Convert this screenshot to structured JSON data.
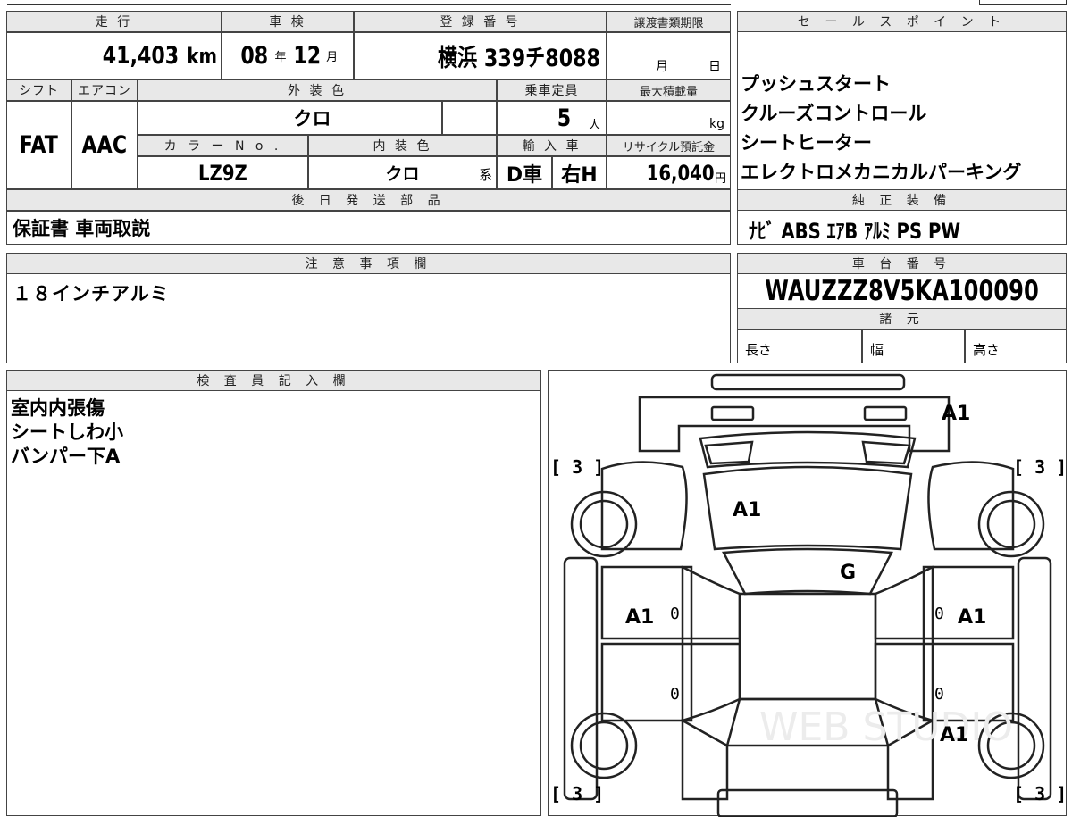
{
  "top_table": {
    "headers": {
      "mileage": "走 行",
      "inspection": "車 検",
      "registration": "登 録 番 号",
      "transfer_deadline": "譲渡書類期限",
      "shift": "シフト",
      "aircon": "エアコン",
      "exterior_color": "外 装 色",
      "capacity": "乗車定員",
      "max_load": "最大積載量",
      "color_no": "カ ラ ー N o .",
      "interior_color": "内 装 色",
      "import": "輸 入 車",
      "recycle_fee": "リサイクル預託金",
      "later_parts": "後 日 発 送 部 品"
    },
    "mileage_value": "41,403",
    "mileage_unit": "km",
    "inspection_year": "08",
    "inspection_year_unit": "年",
    "inspection_month": "12",
    "inspection_month_unit": "月",
    "registration_value": "横浜 339チ8088",
    "deadline_month": "月",
    "deadline_day": "日",
    "shift_value": "FAT",
    "aircon_value": "AAC",
    "exterior_color_value": "クロ",
    "capacity_value": "5",
    "capacity_unit": "人",
    "max_load_unit": "kg",
    "color_no_value": "LZ9Z",
    "interior_color_value": "クロ",
    "interior_color_suffix": "系",
    "import_value_1": "D車",
    "import_value_2": "右H",
    "recycle_value": "16,040",
    "recycle_unit": "円",
    "later_parts_value": "保証書 車両取説"
  },
  "sales_points": {
    "header": "セ ー ル ス ポ イ ン ト",
    "items": [
      "プッシュスタート",
      "クルーズコントロール",
      "シートヒーター",
      "エレクトロメカニカルパーキング"
    ]
  },
  "genuine_equipment": {
    "header": "純 正 装 備",
    "value": "ﾅﾋﾞ ABS ｴｱB ｱﾙﾐ PS PW"
  },
  "notes": {
    "header": "注 意 事 項 欄",
    "value": "１８インチアルミ"
  },
  "chassis": {
    "header": "車 台 番 号",
    "value": "WAUZZZ8V5KA100090"
  },
  "specs": {
    "header": "諸 元",
    "length": "長さ",
    "width": "幅",
    "height": "高さ"
  },
  "inspector": {
    "header": "検 査 員 記 入 欄",
    "lines": [
      "室内内張傷",
      "シートしわ小",
      "バンパー下A"
    ]
  },
  "diagram": {
    "marks": {
      "rear_bumper": "A1",
      "hood": "A1",
      "windshield": "G",
      "left_door": "A1",
      "right_door": "A1",
      "front_right": "A1"
    },
    "tire_marks": "[ 3 ]",
    "zero_marks": [
      "0",
      "0",
      "0",
      "0"
    ],
    "watermark": "WEB STUDIO"
  }
}
